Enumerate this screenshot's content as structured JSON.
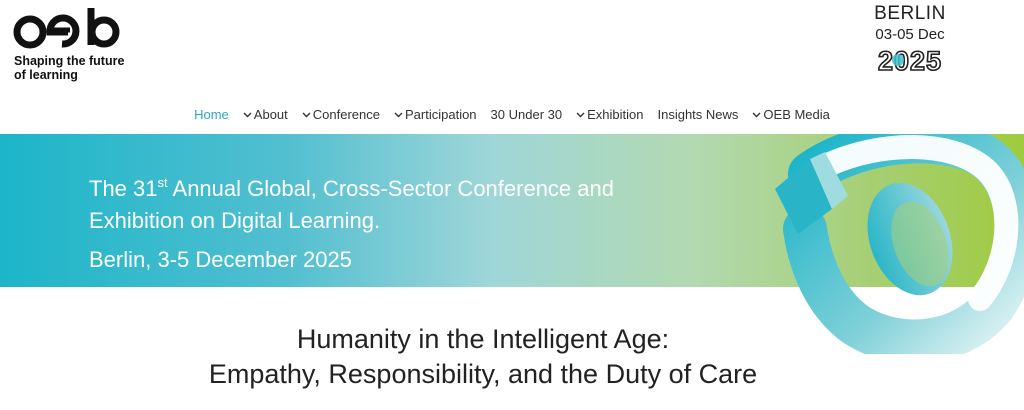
{
  "header": {
    "logo_text": "oeb",
    "tagline_line1": "Shaping the future",
    "tagline_line2": "of learning",
    "event_city": "BERLIN",
    "event_dates": "03-05 Dec",
    "event_year": "2025"
  },
  "nav": {
    "items": [
      {
        "label": "Home",
        "has_dropdown": false,
        "active": true
      },
      {
        "label": "About",
        "has_dropdown": true,
        "active": false
      },
      {
        "label": "Conference",
        "has_dropdown": true,
        "active": false
      },
      {
        "label": "Participation",
        "has_dropdown": true,
        "active": false
      },
      {
        "label": "30 Under 30",
        "has_dropdown": false,
        "active": false
      },
      {
        "label": "Exhibition",
        "has_dropdown": true,
        "active": false
      },
      {
        "label": "Insights News",
        "has_dropdown": false,
        "active": false
      },
      {
        "label": "OEB Media",
        "has_dropdown": true,
        "active": false
      }
    ]
  },
  "hero": {
    "line1_prefix": "The 31",
    "line1_sup": "st",
    "line1_suffix": " Annual Global, Cross-Sector Conference and",
    "line2": "Exhibition on Digital Learning.",
    "location": "Berlin, 3-5 December 2025"
  },
  "theme": {
    "line1": "Humanity in the Intelligent Age:",
    "line2": "Empathy, Responsibility, and the Duty of Care"
  },
  "colors": {
    "accent": "#2aa8c4",
    "hero_start": "#1cb5c9",
    "hero_end": "#9fcb3e"
  }
}
